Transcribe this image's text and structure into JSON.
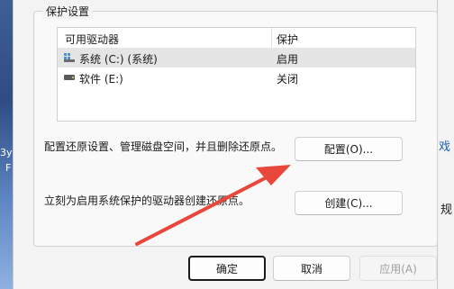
{
  "desktop": {
    "label1": "3y",
    "label2": "F"
  },
  "background_window": {
    "text1": "戏",
    "text2": "规"
  },
  "group": {
    "title": "保护设置"
  },
  "listview": {
    "col_drive": "可用驱动器",
    "col_protection": "保护",
    "rows": [
      {
        "drive": "系统 (C:) (系统)",
        "status": "启用",
        "icon": "system-drive-icon"
      },
      {
        "drive": "软件 (E:)",
        "status": "关闭",
        "icon": "drive-icon"
      }
    ]
  },
  "configure": {
    "description": "配置还原设置、管理磁盘空间，并且删除还原点。",
    "button": "配置(O)..."
  },
  "create": {
    "description": "立刻为启用系统保护的驱动器创建还原点。",
    "button": "创建(C)..."
  },
  "footer": {
    "ok": "确定",
    "cancel": "取消",
    "apply": "应用(A)"
  },
  "colors": {
    "annotation_arrow": "#e8473a",
    "selected_row": "#e5e5e5"
  }
}
